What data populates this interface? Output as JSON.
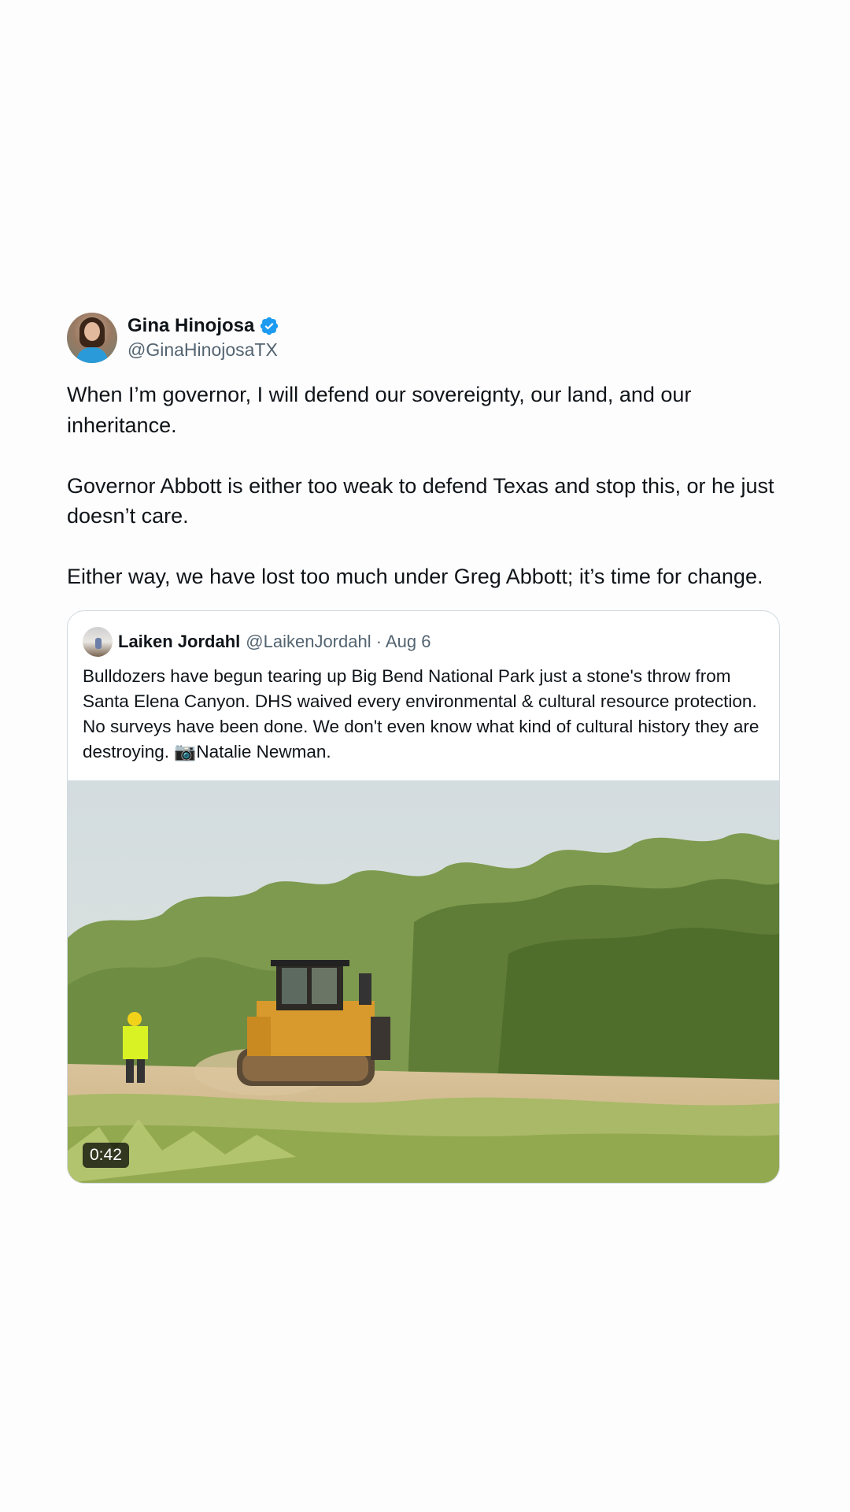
{
  "tweet": {
    "author": {
      "display_name": "Gina Hinojosa",
      "handle": "@GinaHinojosaTX",
      "verified": true,
      "verified_icon": "verified-badge-icon"
    },
    "paragraphs": [
      "When I’m governor, I will defend our sovereignty, our land, and our inheritance.",
      "Governor Abbott is either too weak to defend Texas and stop this, or he just doesn’t care.",
      "Either way, we have lost too much under Greg Abbott; it’s time for change."
    ]
  },
  "quoted_tweet": {
    "display_name": "Laiken Jordahl",
    "handle_date": "@LaikenJordahl · Aug 6",
    "text": "Bulldozers have begun tearing up Big Bend National Park just a stone's throw from Santa Elena Canyon. DHS waived every environmental & cultural resource protection. No surveys have been done. We don't even know what kind of cultural history they are destroying. 📷Natalie Newman.",
    "video": {
      "duration": "0:42"
    }
  },
  "colors": {
    "verified": "#1d9bf0",
    "secondary_text": "#536471",
    "border": "#cfd9de"
  }
}
